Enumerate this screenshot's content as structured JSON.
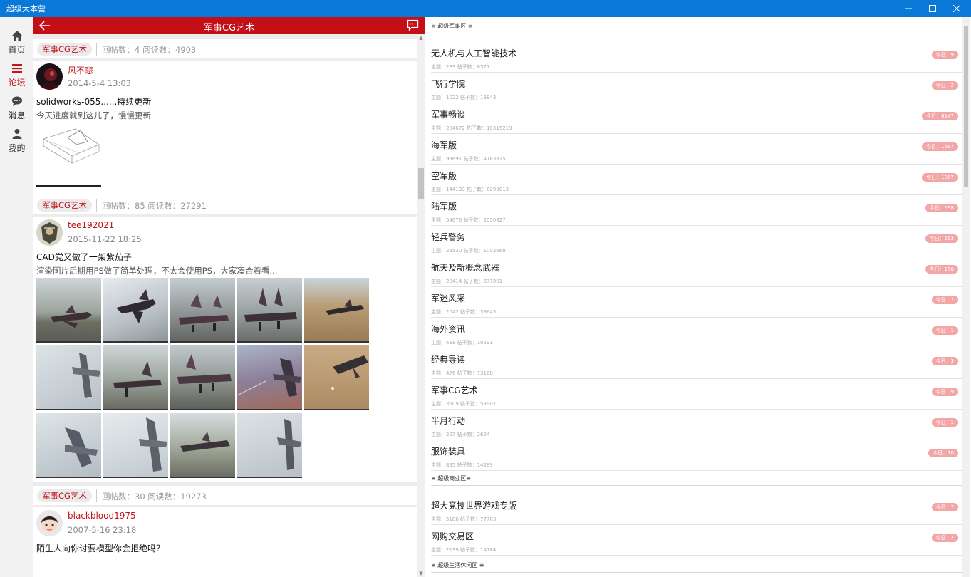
{
  "window": {
    "title": "超级大本营"
  },
  "nav": [
    {
      "label": "首页",
      "icon": "home-icon"
    },
    {
      "label": "论坛",
      "icon": "list-icon",
      "active": true
    },
    {
      "label": "消息",
      "icon": "chat-icon"
    },
    {
      "label": "我的",
      "icon": "user-icon"
    }
  ],
  "middle": {
    "header_title": "军事CG艺术",
    "top_meta": {
      "tag": "军事CG艺术",
      "text": "回帖数：4   阅读数：4903"
    },
    "posts": [
      {
        "author": "风不悲",
        "date": "2014-5-4 13:03",
        "title": "solidworks-055......持续更新",
        "desc": "今天进度就到这儿了，慢慢更新",
        "meta": {
          "tag": "军事CG艺术",
          "text": "回帖数：85   阅读数：27291"
        }
      },
      {
        "author": "tee192021",
        "date": "2015-11-22 18:25",
        "title": "CAD党又做了一架紫茄子",
        "desc": "渲染图片后期用PS做了简单处理，不太会使用PS，大家凑合着看...",
        "meta": {
          "tag": "军事CG艺术",
          "text": "回帖数：30   阅读数：19273"
        }
      },
      {
        "author": "blackblood1975",
        "date": "2007-5-16 23:18",
        "title": "陌生人向你讨要模型你会拒绝吗？",
        "desc": ""
      }
    ]
  },
  "right": {
    "sections": [
      {
        "header": "≡ 超级军事区 ≡",
        "forums": [
          {
            "name": "无人机与人工智能技术",
            "stats": "主题：283    帖子数：8577",
            "today": "今日：9"
          },
          {
            "name": "飞行学院",
            "stats": "主题：1022    帖子数：18843",
            "today": "今日：2"
          },
          {
            "name": "军事畅谈",
            "stats": "主题：284672    帖子数：10315219",
            "today": "今日：6147"
          },
          {
            "name": "海军版",
            "stats": "主题：98691    帖子数：4783815",
            "today": "今日：1687"
          },
          {
            "name": "空军版",
            "stats": "主题：144133    帖子数：6290013",
            "today": "今日：1067"
          },
          {
            "name": "陆军版",
            "stats": "主题：54676    帖子数：2050827",
            "today": "今日：698"
          },
          {
            "name": "轻兵警务",
            "stats": "主题：29530    帖子数：1002668",
            "today": "今日：193"
          },
          {
            "name": "航天及新概念武器",
            "stats": "主题：28414    帖子数：677901",
            "today": "今日：176"
          },
          {
            "name": "军迷风采",
            "stats": "主题：2042    帖子数：59645",
            "today": "今日：7"
          },
          {
            "name": "海外资讯",
            "stats": "主题：618    帖子数：10291",
            "today": "今日：1"
          },
          {
            "name": "经典导读",
            "stats": "主题：476    帖子数：73168",
            "today": "今日：3"
          },
          {
            "name": "军事CG艺术",
            "stats": "主题：3509    帖子数：53907",
            "today": "今日：9"
          },
          {
            "name": "半月行动",
            "stats": "主题：227    帖子数：2624",
            "today": "今日：1"
          },
          {
            "name": "服饰装具",
            "stats": "主题：895    帖子数：14289",
            "today": "今日：10"
          }
        ]
      },
      {
        "header": "≡ 超级商业区≡",
        "forums": [
          {
            "name": "超大竞技世界游戏专版",
            "stats": "主题：5186    帖子数：77783",
            "today": "今日：7"
          },
          {
            "name": "网购交易区",
            "stats": "主题：2139    帖子数：14784",
            "today": "今日：2"
          }
        ]
      },
      {
        "header": "≡ 超级生活休闲区 ≡",
        "forums": []
      }
    ]
  },
  "colors": {
    "titlebar": "#0a78d7",
    "accent_red": "#c50f16",
    "today_badge": "#f3a6a6"
  }
}
